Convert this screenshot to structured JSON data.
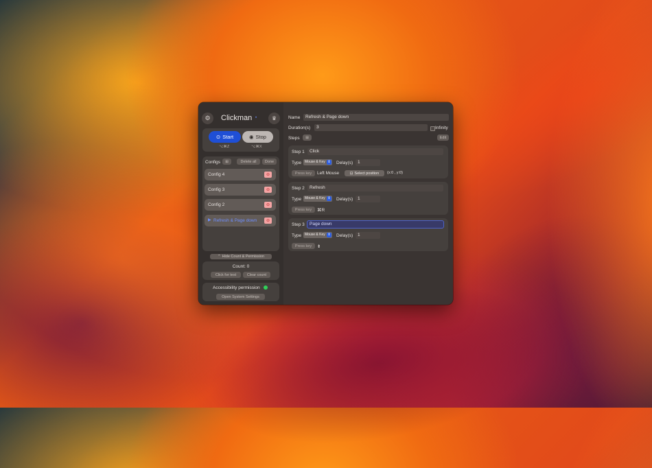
{
  "window": {
    "app_title": "Clickman",
    "badge": "•"
  },
  "run": {
    "start_label": "Start",
    "stop_label": "Stop",
    "start_shortcut": "⌥⌘Z",
    "stop_shortcut": "⌥⌘X"
  },
  "configs": {
    "label": "Configs",
    "delete_all_label": "Delete all",
    "done_label": "Done",
    "items": [
      {
        "label": "Config 4",
        "active": false
      },
      {
        "label": "Config 3",
        "active": false
      },
      {
        "label": "Config 2",
        "active": false
      },
      {
        "label": "Refresh & Page down",
        "active": true
      }
    ]
  },
  "hide_label": "Hide Count & Permission",
  "count": {
    "text": "Count: 0",
    "click_test_label": "Click for test",
    "clear_label": "Clear count"
  },
  "permission": {
    "text": "Accessibility permission",
    "status_color": "#30d158",
    "open_settings_label": "Open System Settings"
  },
  "editor": {
    "name_label": "Name",
    "name_value": "Refresh & Page down",
    "duration_label": "Duration(s)",
    "duration_value": "3",
    "infinity_label": "Infinity",
    "steps_label": "Steps",
    "edit_label": "Edit",
    "type_label": "Type",
    "delay_label": "Delay(s)",
    "press_key_label": "Press key",
    "steps": [
      {
        "label": "Step 1",
        "name": "Click",
        "type": "Mouse & Key",
        "delay": "1",
        "key": "Left Mouse",
        "select_position_label": "Select position",
        "position": "(x:0 , y:0)"
      },
      {
        "label": "Step 2",
        "name": "Refresh",
        "type": "Mouse & Key",
        "delay": "1",
        "key": "⌘R"
      },
      {
        "label": "Step 3",
        "name": "Page down",
        "type": "Mouse & Key",
        "delay": "1",
        "key": "⇟"
      }
    ]
  },
  "colors": {
    "accent": "#1f4fd6",
    "active_config": "#6f8fff",
    "delete": "#f5a4a4"
  }
}
